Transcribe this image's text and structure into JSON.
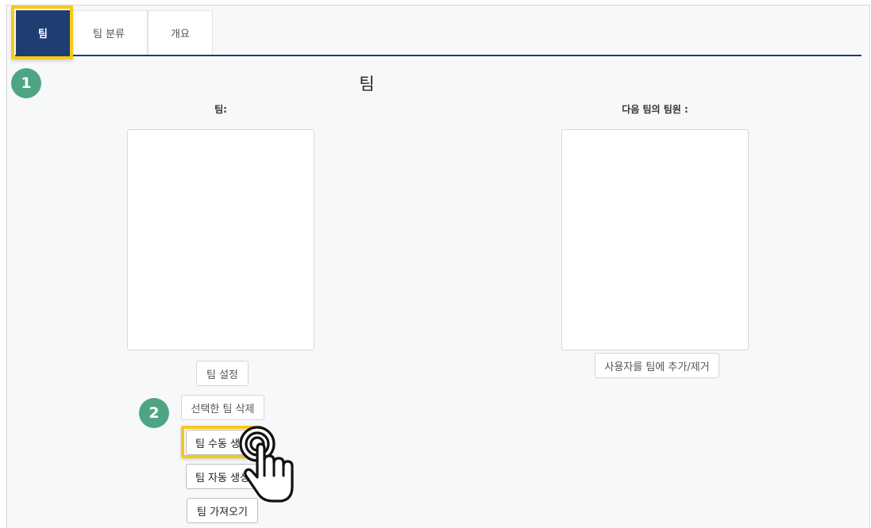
{
  "tabs": [
    {
      "label": "팀",
      "active": true
    },
    {
      "label": "팀 분류",
      "active": false
    },
    {
      "label": "개요",
      "active": false
    }
  ],
  "steps": [
    "1",
    "2"
  ],
  "page": {
    "title": "팀"
  },
  "left_column": {
    "label": "팀:"
  },
  "right_column": {
    "label": "다음 팀의 팀원 :"
  },
  "buttons": {
    "team_settings": "팀 설정",
    "delete_selected": "선택한 팀 삭제",
    "create_manual": "팀 수동 생성",
    "create_auto": "팀 자동 생성",
    "import_teams": "팀 가져오기",
    "add_remove_users": "사용자를 팀에 추가/제거"
  },
  "colors": {
    "accent": "#1f3d73",
    "highlight": "#f6c919",
    "step_badge": "#4fa583"
  },
  "icons": [
    "hand-pointer-icon"
  ]
}
